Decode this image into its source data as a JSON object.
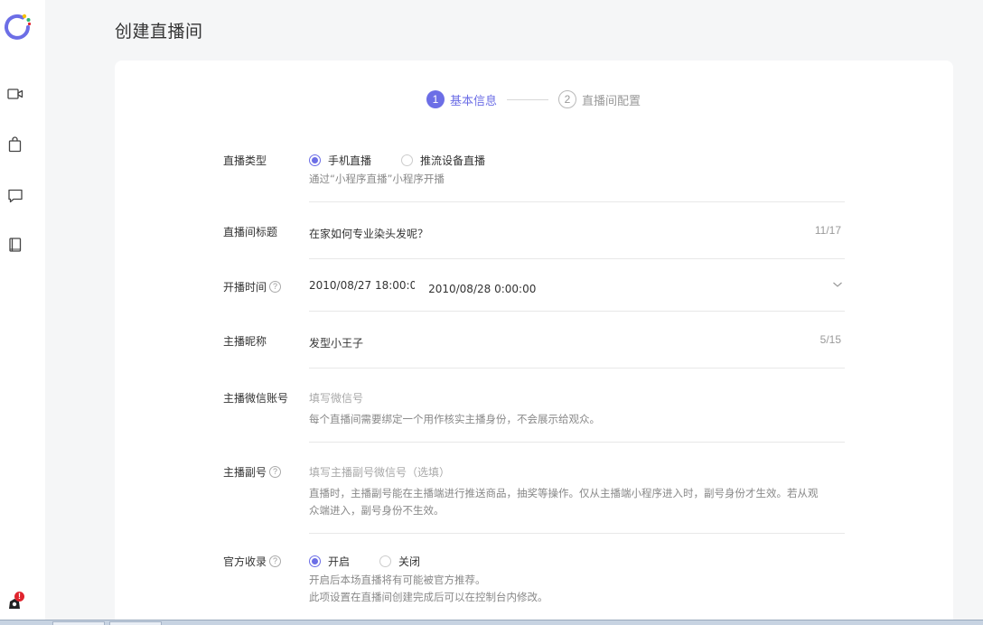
{
  "sidebar": {
    "items": [
      {
        "icon": "video-camera-icon"
      },
      {
        "icon": "shopping-bag-icon"
      },
      {
        "icon": "chat-bubble-icon"
      },
      {
        "icon": "book-icon"
      }
    ],
    "notification_badge": "!"
  },
  "page_title": "创建直播间",
  "steps": [
    {
      "num": "1",
      "label": "基本信息",
      "active": true
    },
    {
      "num": "2",
      "label": "直播间配置",
      "active": false
    }
  ],
  "form": {
    "live_type": {
      "label": "直播类型",
      "options": [
        "手机直播",
        "推流设备直播"
      ],
      "selected": "手机直播",
      "hint": "通过“小程序直播”小程序开播"
    },
    "room_title": {
      "label": "直播间标题",
      "value": "在家如何专业染头发呢？",
      "counter": "11/17"
    },
    "start_time": {
      "label": "开播时间",
      "help": "?",
      "start": "2010/08/27 18:00:0(",
      "end": "2010/08/28 0:00:00"
    },
    "anchor_nickname": {
      "label": "主播昵称",
      "value": "发型小王子",
      "counter": "5/15"
    },
    "anchor_wechat": {
      "label": "主播微信账号",
      "placeholder": "填写微信号",
      "hint": "每个直播间需要绑定一个用作核实主播身份，不会展示给观众。"
    },
    "anchor_sub": {
      "label": "主播副号",
      "help": "?",
      "placeholder": "填写主播副号微信号（选填）",
      "hint_line1": "直播时，主播副号能在主播端进行推送商品，抽奖等操作。仅从主播端小程序进入时，副号身份才生效。若从观",
      "hint_line2": "众端进入，副号身份不生效。"
    },
    "official_include": {
      "label": "官方收录",
      "help": "?",
      "options": [
        "开启",
        "关闭"
      ],
      "selected": "开启",
      "hint_line1": "开启后本场直播将有可能被官方推荐。",
      "hint_line2": "此项设置在直播间创建完成后可以在控制台内修改。"
    }
  },
  "colors": {
    "accent": "#6c6ee6",
    "background": "#f5f6f7",
    "card": "#ffffff",
    "badge": "#e0242e"
  }
}
